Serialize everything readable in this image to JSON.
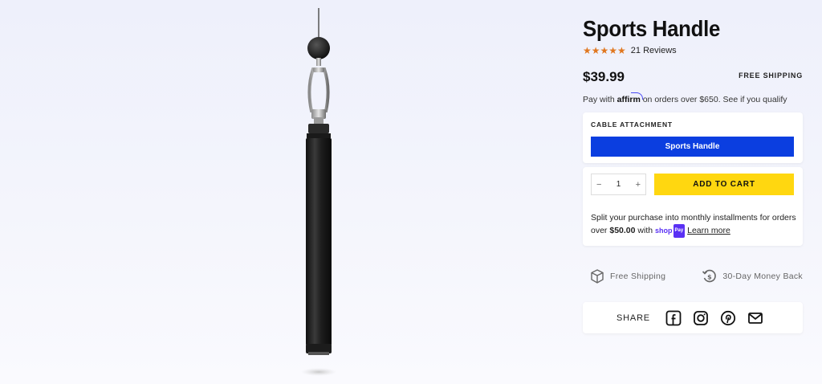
{
  "product": {
    "title": "Sports Handle",
    "stars": "★★★★★",
    "reviews": "21 Reviews",
    "price": "$39.99",
    "free_shipping_label": "FREE SHIPPING"
  },
  "affirm": {
    "prefix": "Pay with",
    "logo": "affirm",
    "suffix": "on orders over $650. See if you qualify"
  },
  "options": {
    "label": "CABLE ATTACHMENT",
    "selected": "Sports Handle"
  },
  "cart": {
    "minus": "−",
    "quantity": "1",
    "plus": "+",
    "add_label": "ADD TO CART"
  },
  "shop_pay": {
    "text_before": "Split your purchase into monthly installments for orders over",
    "amount": "$50.00",
    "with": "with",
    "brand": "shop",
    "brand_pay": "Pay",
    "learn_more": "Learn more"
  },
  "features": {
    "shipping": "Free Shipping",
    "money_back": "30-Day Money Back"
  },
  "share": {
    "label": "SHARE"
  },
  "colors": {
    "accent_blue": "#0b3ee0",
    "cart_yellow": "#ffd710",
    "star_orange": "#e0771f"
  },
  "icons": [
    "facebook-icon",
    "instagram-icon",
    "pinterest-icon",
    "mail-icon",
    "box-icon",
    "refund-icon"
  ]
}
